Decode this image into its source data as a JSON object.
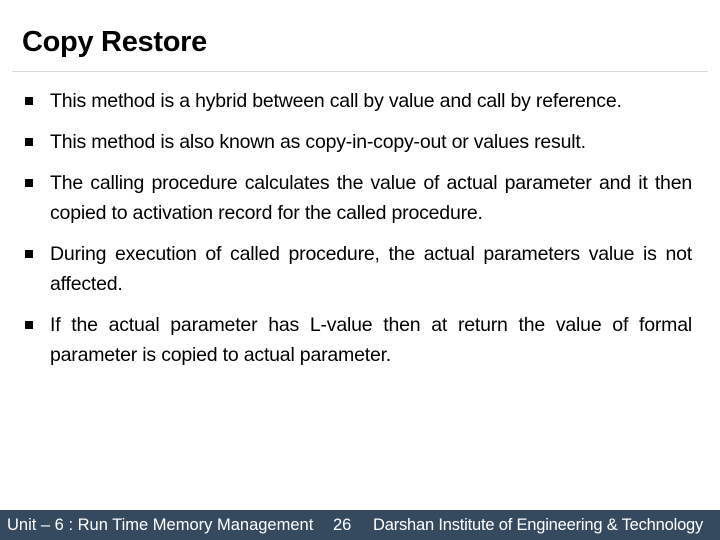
{
  "slide": {
    "title": "Copy Restore",
    "bullets": [
      {
        "text": "This method is a hybrid between call by value and call by reference."
      },
      {
        "text": "This method is also known as copy-in-copy-out or values result."
      },
      {
        "text": "The calling procedure calculates the value of actual parameter and it then copied to activation record for the called procedure."
      },
      {
        "text": "During execution of called procedure, the actual parameters value is not affected."
      },
      {
        "text": "If the actual parameter has L-value then at return the value of formal parameter is copied to actual parameter."
      }
    ],
    "bullet_icon": "square-bullet-icon"
  },
  "footer": {
    "unit": "Unit – 6 : Run Time Memory Management",
    "page_number": "26",
    "institute": "Darshan Institute of Engineering & Technology",
    "background_color": "#354a5f"
  }
}
